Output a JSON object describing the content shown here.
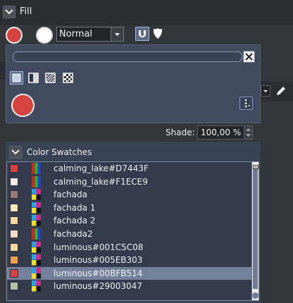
{
  "fill": {
    "title": "Fill"
  },
  "toolbar": {
    "primary_color": "#d7443f",
    "secondary_color": "#ffffff",
    "blend_mode": "Normal"
  },
  "popup": {
    "search_placeholder": "",
    "selected_color": "#d7443f"
  },
  "shade": {
    "label": "Shade:",
    "value": "100,00 %"
  },
  "swatches": {
    "title": "Color Swatches",
    "items": [
      {
        "name": "calming_lake#D7443F",
        "color": "#d7443f",
        "model": "rgb",
        "selected": false
      },
      {
        "name": "calming_lake#F1ECE9",
        "color": "#f1ece9",
        "model": "rgb",
        "selected": false
      },
      {
        "name": "fachada",
        "color": "#9a7a7a",
        "model": "cmyk",
        "selected": false
      },
      {
        "name": "fachada 1",
        "color": "#fbe8b7",
        "model": "cmyk",
        "selected": false
      },
      {
        "name": "fachada 2",
        "color": "#f7d5a6",
        "model": "cmyk",
        "selected": false
      },
      {
        "name": "fachada2",
        "color": "#f1dcc8",
        "model": "rgb",
        "selected": false
      },
      {
        "name": "luminous#001C5C08",
        "color": "#f6d6a0",
        "model": "cmyk",
        "selected": false
      },
      {
        "name": "luminous#005EB303",
        "color": "#f3a24c",
        "model": "cmyk",
        "selected": false
      },
      {
        "name": "luminous#00BFB514",
        "color": "#d7443f",
        "model": "cmyk",
        "selected": true
      },
      {
        "name": "luminous#29003047",
        "color": "#b7c1a6",
        "model": "cmyk",
        "selected": false
      }
    ]
  }
}
